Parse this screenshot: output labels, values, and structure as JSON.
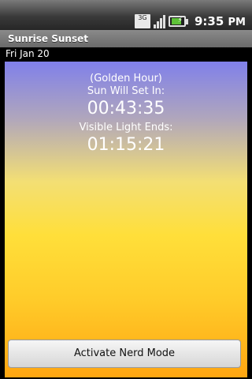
{
  "status_bar": {
    "network": "3G",
    "time": "9:35",
    "period": "PM",
    "icons": [
      "3g-icon",
      "signal-icon",
      "battery-charging-icon"
    ]
  },
  "app": {
    "title": "Sunrise Sunset",
    "date": "Fri Jan 20"
  },
  "main": {
    "phase_label": "(Golden Hour)",
    "sunset_label": "Sun Will Set In:",
    "sunset_timer": "00:43:35",
    "light_label": "Visible Light Ends:",
    "light_timer": "01:15:21",
    "button_label": "Activate Nerd Mode"
  },
  "colors": {
    "sky_top": "#8080ea",
    "sky_mid": "#ffdf3a",
    "sky_bottom": "#ffa612",
    "battery_green": "#5ec238"
  }
}
